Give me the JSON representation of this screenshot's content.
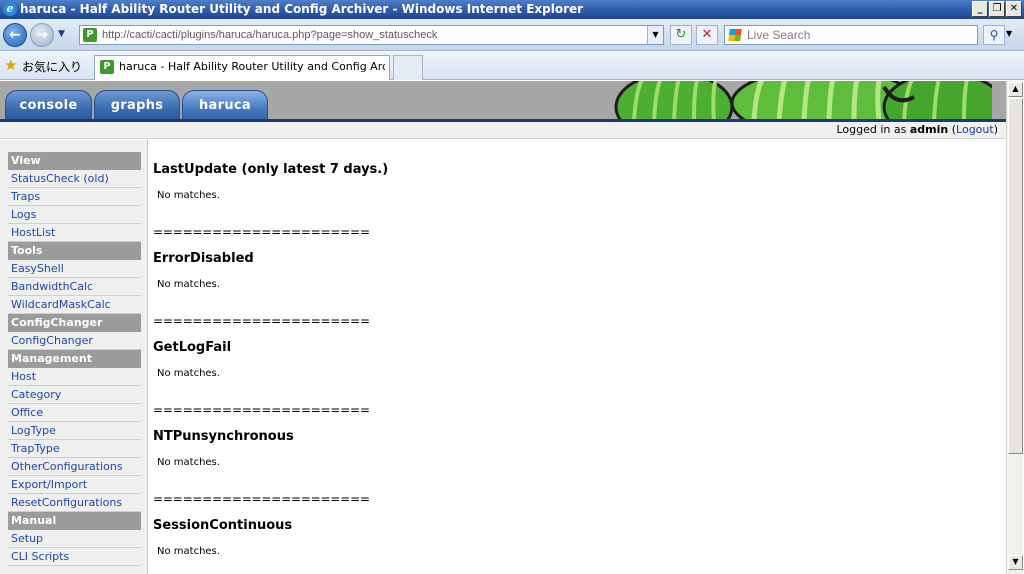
{
  "window": {
    "title": "haruca - Half Ability Router Utility and Config Archiver - Windows Internet Explorer",
    "minimize_glyph": "_",
    "restore_glyph": "❐",
    "close_glyph": "✕"
  },
  "navbar": {
    "url": "http://cacti/cacti/plugins/haruca/haruca.php?page=show_statuscheck",
    "search_placeholder": "Live Search"
  },
  "favorites": {
    "label": "お気に入り",
    "active_tab_title": "haruca - Half Ability Router Utility and Config Arc..."
  },
  "cacti": {
    "tabs": [
      {
        "label": "console"
      },
      {
        "label": "graphs"
      },
      {
        "label": "haruca"
      }
    ],
    "login": {
      "prefix": "Logged in as",
      "user": "admin",
      "logout": "Logout"
    }
  },
  "sidebar": {
    "view_header": "View",
    "view_items": [
      "StatusCheck (old)",
      "Traps",
      "Logs",
      "HostList"
    ],
    "tools_header": "Tools",
    "tools_items": [
      "EasyShell",
      "BandwidthCalc",
      "WildcardMaskCalc"
    ],
    "configchanger_header": "ConfigChanger",
    "configchanger_items": [
      "ConfigChanger"
    ],
    "management_header": "Management",
    "management_items": [
      "Host",
      "Category",
      "Office",
      "LogType",
      "TrapType",
      "OtherConfigurations",
      "Export/Import",
      "ResetConfigurations"
    ],
    "manual_header": "Manual",
    "manual_items": [
      "Setup",
      "CLI Scripts"
    ]
  },
  "content": {
    "separator": "======================",
    "sections": [
      {
        "title": "LastUpdate (only latest 7 days.)",
        "message": "No matches."
      },
      {
        "title": "ErrorDisabled",
        "message": "No matches."
      },
      {
        "title": "GetLogFail",
        "message": "No matches."
      },
      {
        "title": "NTPunsynchronous",
        "message": "No matches."
      },
      {
        "title": "SessionContinuous",
        "message": "No matches."
      }
    ]
  }
}
